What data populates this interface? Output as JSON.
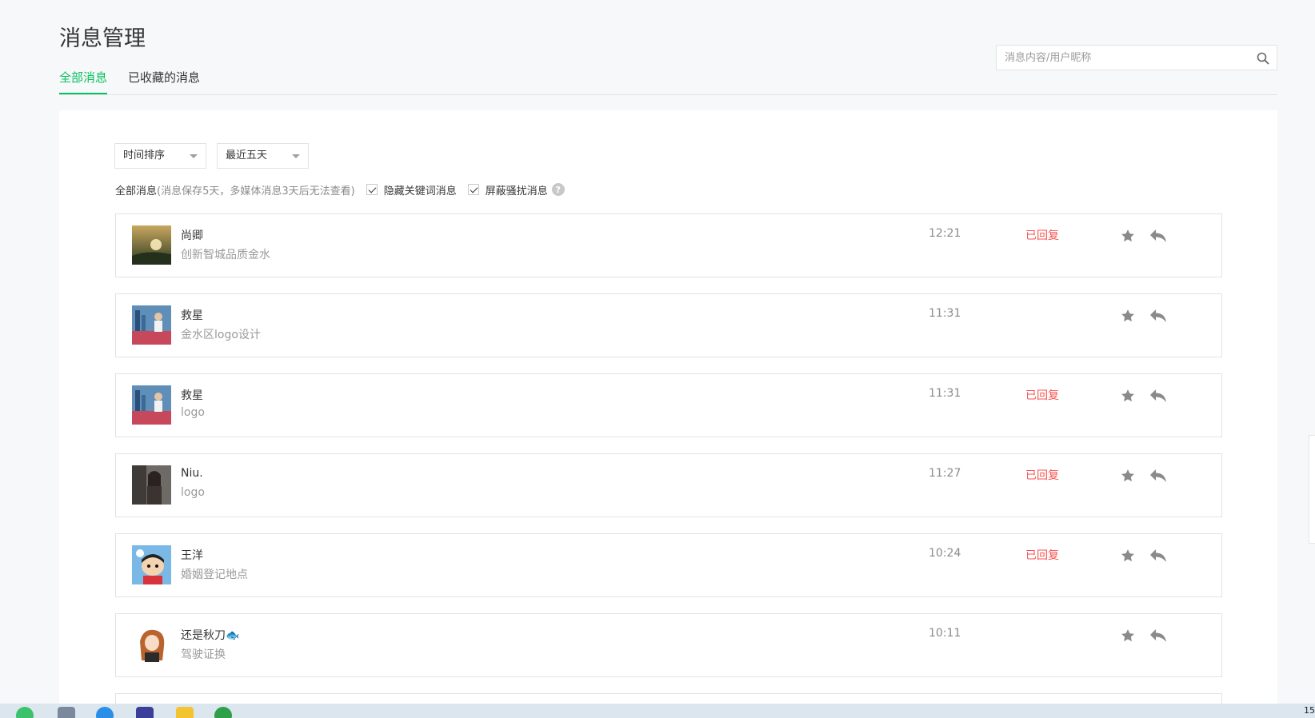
{
  "page": {
    "title": "消息管理"
  },
  "tabs": [
    {
      "label": "全部消息",
      "active": true
    },
    {
      "label": "已收藏的消息",
      "active": false
    }
  ],
  "search": {
    "placeholder": "消息内容/用户昵称",
    "value": ""
  },
  "filters": {
    "sort": {
      "selected": "时间排序"
    },
    "range": {
      "selected": "最近五天"
    },
    "summary_label": "全部消息",
    "summary_note": "(消息保存5天，多媒体消息3天后无法查看)",
    "hide_keyword": {
      "label": "隐藏关键词消息",
      "checked": true
    },
    "block_harass": {
      "label": "屏蔽骚扰消息",
      "checked": true
    },
    "help_glyph": "?"
  },
  "messages": [
    {
      "nickname": "尚卿",
      "content": "创新智城品质金水",
      "time": "12:21",
      "status": "已回复",
      "avatar": "sunset-photo"
    },
    {
      "nickname": "救星",
      "content": "金水区logo设计",
      "time": "11:31",
      "status": "",
      "avatar": "person-city-photo"
    },
    {
      "nickname": "救星",
      "content": "logo",
      "time": "11:31",
      "status": "已回复",
      "avatar": "person-city-photo"
    },
    {
      "nickname": "Niu.",
      "content": "logo",
      "time": "11:27",
      "status": "已回复",
      "avatar": "woman-photo"
    },
    {
      "nickname": "王洋",
      "content": "婚姻登记地点",
      "time": "10:24",
      "status": "已回复",
      "avatar": "cartoon-boy"
    },
    {
      "nickname": "还是秋刀🐟",
      "content": "驾驶证换",
      "time": "10:11",
      "status": "",
      "avatar": "anime-girl"
    }
  ],
  "colors": {
    "accent": "#07c160",
    "replied": "#fa5151",
    "muted": "#9a9a9a"
  },
  "taskbar": {
    "clock": "15"
  }
}
